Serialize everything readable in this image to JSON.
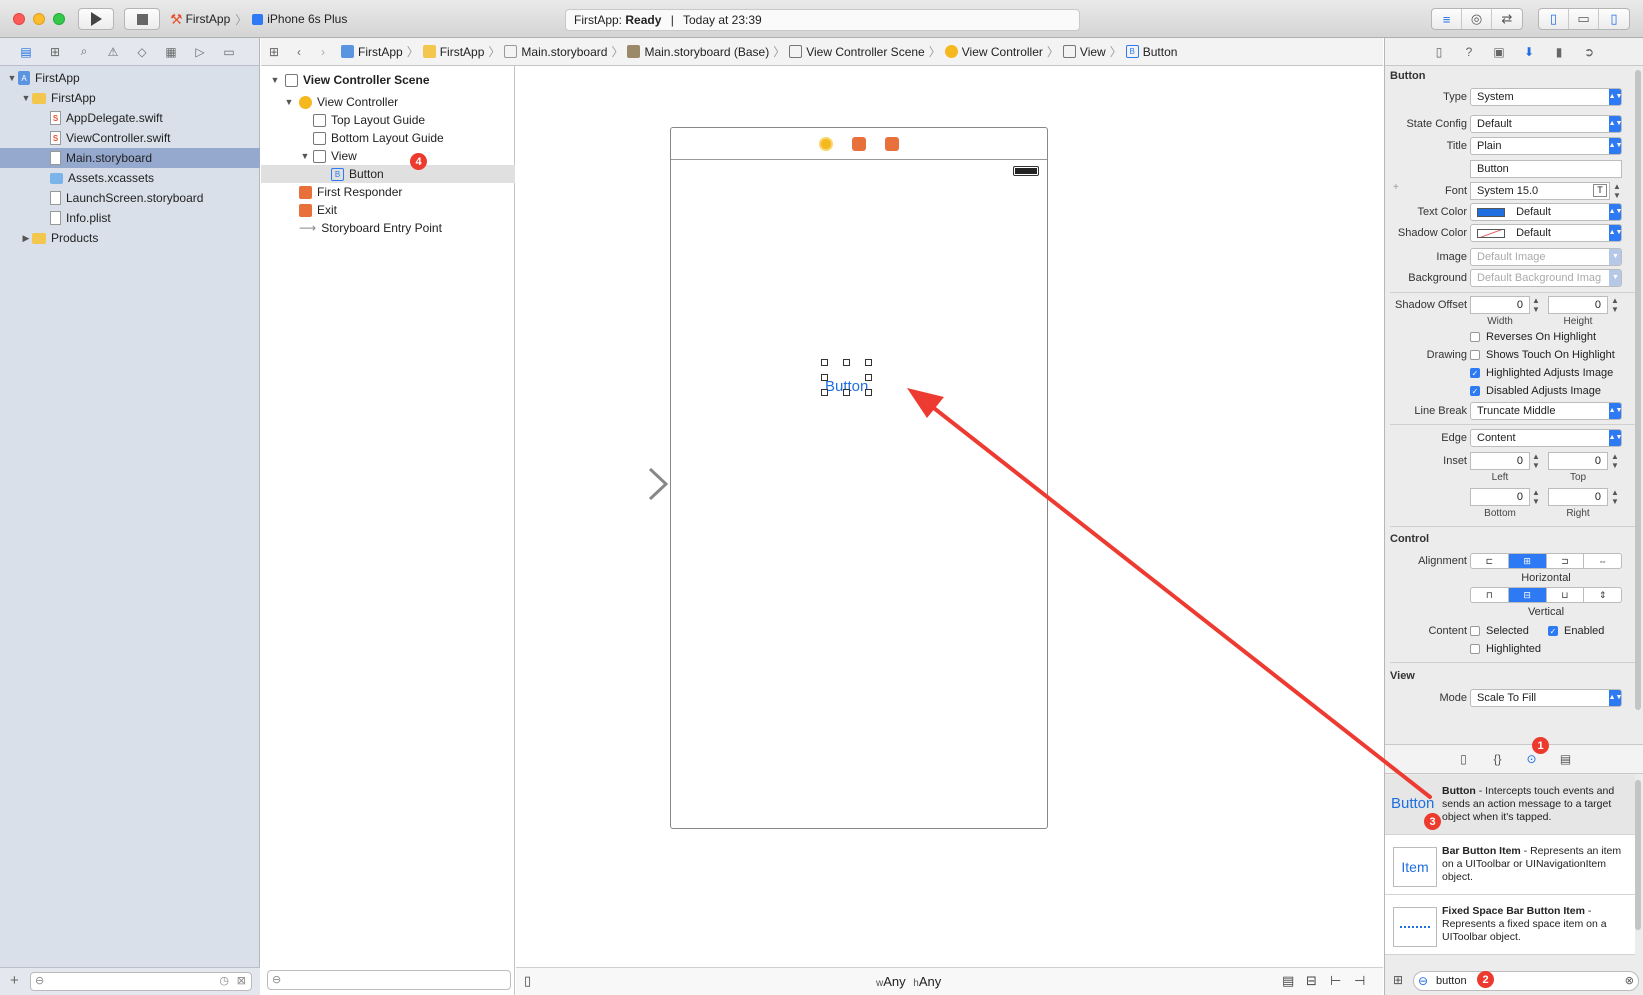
{
  "toolbar": {
    "scheme_app": "FirstApp",
    "scheme_device": "iPhone 6s Plus",
    "status_app": "FirstApp:",
    "status_state": "Ready",
    "status_sep": "|",
    "status_time": "Today at 23:39"
  },
  "navigator": {
    "items": [
      {
        "label": "FirstApp"
      },
      {
        "label": "FirstApp"
      },
      {
        "label": "AppDelegate.swift"
      },
      {
        "label": "ViewController.swift"
      },
      {
        "label": "Main.storyboard"
      },
      {
        "label": "Assets.xcassets"
      },
      {
        "label": "LaunchScreen.storyboard"
      },
      {
        "label": "Info.plist"
      },
      {
        "label": "Products"
      }
    ]
  },
  "jumpbar": {
    "crumbs": [
      "FirstApp",
      "FirstApp",
      "Main.storyboard",
      "Main.storyboard (Base)",
      "View Controller Scene",
      "View Controller",
      "View",
      "Button"
    ]
  },
  "outline": {
    "scene": "View Controller Scene",
    "view_controller": "View Controller",
    "top_guide": "Top Layout Guide",
    "bottom_guide": "Bottom Layout Guide",
    "view": "View",
    "button": "Button",
    "first_responder": "First Responder",
    "exit": "Exit",
    "entry_point": "Storyboard Entry Point"
  },
  "canvas": {
    "button_title": "Button",
    "size_w_prefix": "w",
    "size_w": "Any",
    "size_h_prefix": "h",
    "size_h": "Any"
  },
  "inspector": {
    "button_section": "Button",
    "type_label": "Type",
    "type_value": "System",
    "state_label": "State Config",
    "state_value": "Default",
    "title_label": "Title",
    "title_value": "Plain",
    "title_text": "Button",
    "font_label": "Font",
    "font_value": "System 15.0",
    "text_color_label": "Text Color",
    "text_color_value": "Default",
    "shadow_color_label": "Shadow Color",
    "shadow_color_value": "Default",
    "image_label": "Image",
    "image_placeholder": "Default Image",
    "background_label": "Background",
    "background_placeholder": "Default Background Imag",
    "shadow_offset_label": "Shadow Offset",
    "shadow_width": "0",
    "shadow_height": "0",
    "width_caption": "Width",
    "height_caption": "Height",
    "reverses": "Reverses On Highlight",
    "drawing_label": "Drawing",
    "shows_touch": "Shows Touch On Highlight",
    "highlighted_adjusts": "Highlighted Adjusts Image",
    "disabled_adjusts": "Disabled Adjusts Image",
    "line_break_label": "Line Break",
    "line_break_value": "Truncate Middle",
    "edge_label": "Edge",
    "edge_value": "Content",
    "inset_label": "Inset",
    "inset_left": "0",
    "inset_top": "0",
    "inset_bottom": "0",
    "inset_right": "0",
    "left_caption": "Left",
    "top_caption": "Top",
    "bottom_caption": "Bottom",
    "right_caption": "Right",
    "control_section": "Control",
    "alignment_label": "Alignment",
    "horizontal_caption": "Horizontal",
    "vertical_caption": "Vertical",
    "content_label": "Content",
    "selected": "Selected",
    "enabled": "Enabled",
    "highlighted": "Highlighted",
    "view_section": "View",
    "mode_label": "Mode",
    "mode_value": "Scale To Fill"
  },
  "library": {
    "items": [
      {
        "icon_text": "Button",
        "name": "Button",
        "desc": " - Intercepts touch events and sends an action message to a target object when it's tapped."
      },
      {
        "icon_text": "Item",
        "name": "Bar Button Item",
        "desc": " - Represents an item on a UIToolbar or UINavigationItem object."
      },
      {
        "icon_text": "",
        "name": "Fixed Space Bar Button Item",
        "desc": " - Represents a fixed space item on a UIToolbar object."
      }
    ],
    "search_value": "button"
  },
  "badges": [
    "1",
    "2",
    "3",
    "4"
  ],
  "colors": {
    "accent": "#1f6fe0",
    "badge": "#ed3a2e",
    "selection": "#95a9cf"
  }
}
